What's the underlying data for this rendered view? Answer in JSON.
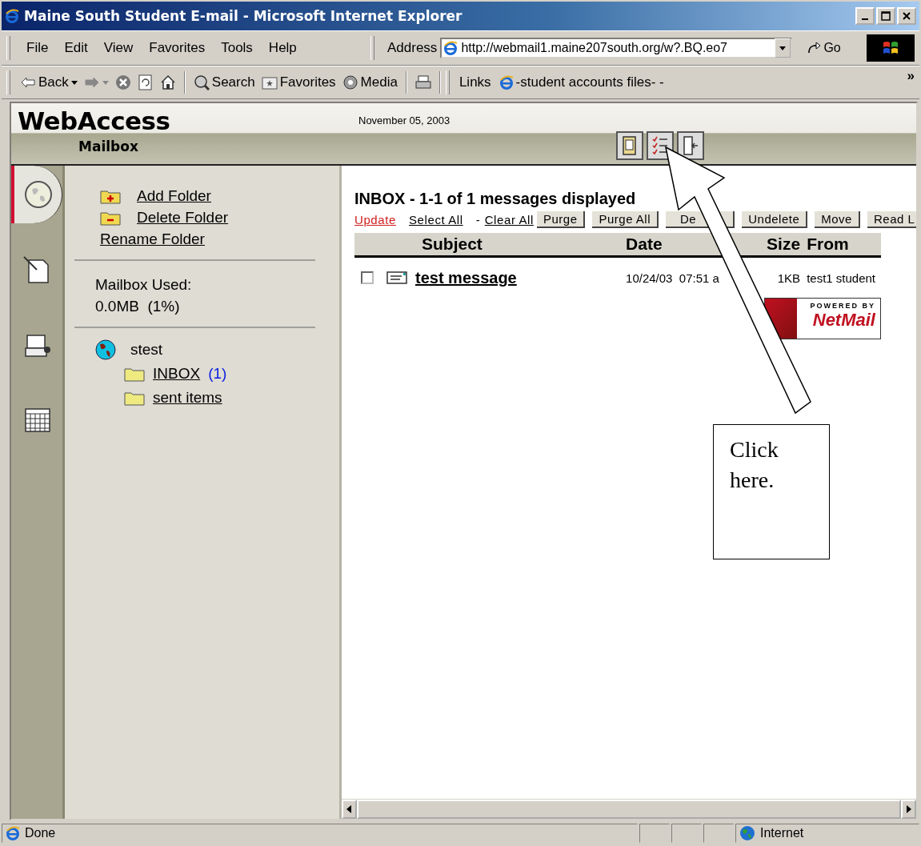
{
  "window": {
    "title": "Maine South Student E-mail - Microsoft Internet Explorer"
  },
  "menu": [
    "File",
    "Edit",
    "View",
    "Favorites",
    "Tools",
    "Help"
  ],
  "address": {
    "label": "Address",
    "value": "http://webmail1.maine207south.org/w?.BQ.eo7",
    "go": "Go"
  },
  "toolbar": [
    {
      "kind": "back",
      "label": "Back"
    },
    {
      "kind": "forward"
    },
    {
      "kind": "stop"
    },
    {
      "kind": "refresh"
    },
    {
      "kind": "home"
    },
    {
      "kind": "search",
      "label": "Search"
    },
    {
      "kind": "favorites",
      "label": "Favorites"
    },
    {
      "kind": "media",
      "label": "Media"
    },
    {
      "kind": "print"
    }
  ],
  "links": {
    "label": "Links",
    "items": [
      "-student accounts files- -"
    ],
    "overflow": "»"
  },
  "header": {
    "title": "WebAccess",
    "subtitle": "Mailbox",
    "date": "November 05, 2003"
  },
  "side_tabs": [
    {
      "kind": "globe",
      "selected": true
    },
    {
      "kind": "compose",
      "selected": false
    },
    {
      "kind": "address-book",
      "selected": false
    },
    {
      "kind": "calendar",
      "selected": false
    }
  ],
  "folder_actions": [
    {
      "kind": "add",
      "label": "Add Folder"
    },
    {
      "kind": "delete",
      "label": "Delete Folder"
    },
    {
      "kind": "rename",
      "label": "Rename Folder"
    }
  ],
  "mailbox_used": {
    "label": "Mailbox Used:",
    "value": "0.0MB  (1%)"
  },
  "tree": {
    "label": "stest",
    "children": [
      {
        "label": "INBOX",
        "count": "(1)"
      },
      {
        "label": "sent items"
      }
    ]
  },
  "inbox": {
    "heading": "INBOX - 1-1 of 1 messages displayed",
    "actions": [
      {
        "kind": "link",
        "label": "Update",
        "active": true
      },
      {
        "kind": "link",
        "label": "Select All",
        "active": false
      },
      {
        "kind": "text",
        "label": "-"
      },
      {
        "kind": "link",
        "label": "Clear All",
        "active": false
      },
      {
        "kind": "button",
        "label": "Purge"
      },
      {
        "kind": "button",
        "label": "Purge All"
      },
      {
        "kind": "button",
        "label": "De"
      },
      {
        "kind": "button",
        "label": "Undelete"
      },
      {
        "kind": "button",
        "label": "Move"
      },
      {
        "kind": "button",
        "label": "Read L"
      }
    ],
    "columns": [
      "Subject",
      "Date",
      "Size",
      "From"
    ],
    "messages": [
      {
        "checked": false,
        "subject": "test message",
        "date": "10/24/03  07:51 a",
        "size": "1KB",
        "from": "test1 student"
      }
    ],
    "badge": {
      "top": "POWERED BY",
      "name": "NetMail"
    }
  },
  "status_bar": {
    "text": "Done",
    "zone": "Internet"
  },
  "callout": {
    "text": "Click here."
  }
}
